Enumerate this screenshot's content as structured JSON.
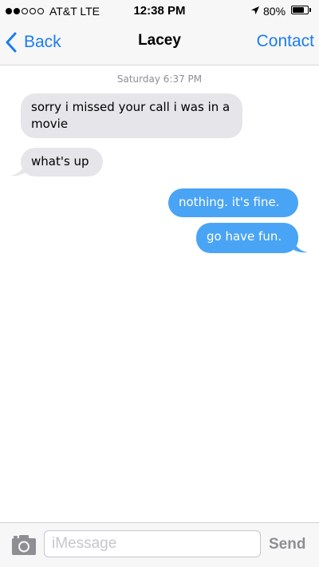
{
  "status_bar": {
    "carrier": "AT&T LTE",
    "time": "12:38 PM",
    "battery": "80%",
    "battery_level": 0.8,
    "signal_bars_filled": 2,
    "signal_bars_total": 5,
    "icons": [
      "signal-dots-icon",
      "location-arrow-icon",
      "battery-icon"
    ]
  },
  "nav": {
    "back_label": "Back",
    "title": "Lacey",
    "contact_label": "Contact",
    "accent_color": "#1b7cf4"
  },
  "conversation": {
    "timestamp": "Saturday 6:37 PM",
    "messages": [
      {
        "direction": "incoming",
        "text": "sorry i missed your call i was in a movie"
      },
      {
        "direction": "incoming",
        "text": "what's up"
      },
      {
        "direction": "outgoing",
        "text": "nothing. it's fine."
      },
      {
        "direction": "outgoing",
        "text": "go have fun."
      }
    ],
    "incoming_color": "#e5e5ea",
    "outgoing_color": "#4aa4f5"
  },
  "composer": {
    "placeholder": "iMessage",
    "send_label": "Send",
    "camera_icon": "camera-icon"
  }
}
